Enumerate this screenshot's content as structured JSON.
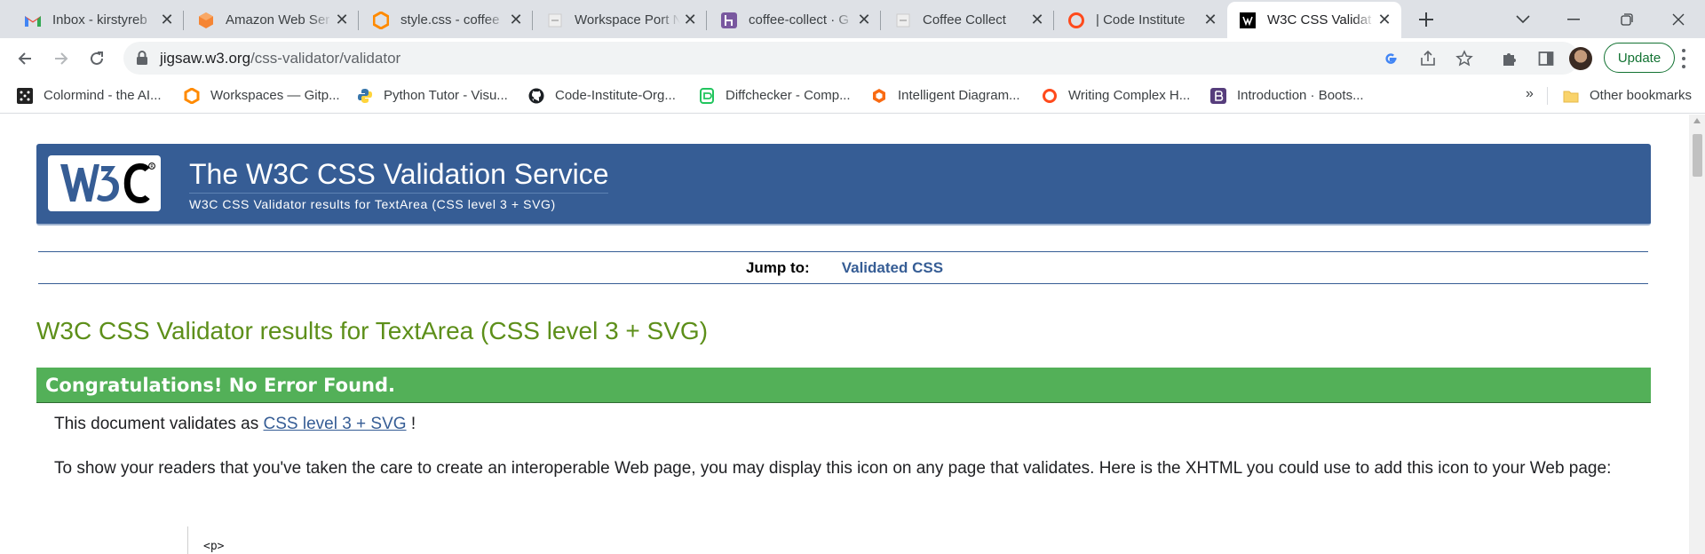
{
  "browser": {
    "tabs": [
      {
        "title": "Inbox - kirstyreb",
        "icon": "gmail-icon",
        "active": false
      },
      {
        "title": "Amazon Web Ser",
        "icon": "aws-icon",
        "active": false
      },
      {
        "title": "style.css - coffee",
        "icon": "gitpod-icon",
        "active": false
      },
      {
        "title": "Workspace Port N",
        "icon": "blank-page-icon",
        "active": false
      },
      {
        "title": "coffee-collect · G",
        "icon": "heroku-icon",
        "active": false
      },
      {
        "title": "Coffee Collect",
        "icon": "blank-page-icon",
        "active": false
      },
      {
        "title": "| Code Institute",
        "icon": "code-institute-icon",
        "active": false
      },
      {
        "title": "W3C CSS Validat",
        "icon": "w3c-icon",
        "active": true
      }
    ],
    "address": {
      "domain": "jigsaw.w3.org",
      "path": "/css-validator/validator"
    },
    "update_label": "Update",
    "bookmarks": [
      {
        "label": "Colormind - the AI...",
        "icon": "colormind-icon"
      },
      {
        "label": "Workspaces — Gitp...",
        "icon": "gitpod-icon"
      },
      {
        "label": "Python Tutor - Visu...",
        "icon": "python-icon"
      },
      {
        "label": "Code-Institute-Org...",
        "icon": "github-icon"
      },
      {
        "label": "Diffchecker - Comp...",
        "icon": "diffchecker-icon"
      },
      {
        "label": "Intelligent Diagram...",
        "icon": "lucidchart-icon"
      },
      {
        "label": "Writing Complex H...",
        "icon": "code-institute-icon"
      },
      {
        "label": "Introduction · Boots...",
        "icon": "bootstrap-icon"
      }
    ],
    "bookmarks_more": "»",
    "other_bookmarks": "Other bookmarks"
  },
  "page": {
    "banner": {
      "title": "The W3C CSS Validation Service",
      "subtitle": "W3C CSS Validator results for TextArea (CSS level 3 + SVG)"
    },
    "jump": {
      "label": "Jump to:",
      "link": "Validated CSS"
    },
    "results_title": "W3C CSS Validator results for TextArea (CSS level 3 + SVG)",
    "congrats": "Congratulations! No Error Found.",
    "validates": {
      "prefix": "This document validates as ",
      "link": "CSS level 3 + SVG",
      "suffix": " !"
    },
    "readers_text": "To show your readers that you've taken the care to create an interoperable Web page, you may display this icon on any page that validates. Here is the XHTML you could use to add this icon to your Web page:",
    "code_first_line": "<p>"
  },
  "colors": {
    "banner": "#365d95",
    "results_title": "#5d8f1a",
    "congrats_bg": "#53b058",
    "link": "#365d95"
  }
}
